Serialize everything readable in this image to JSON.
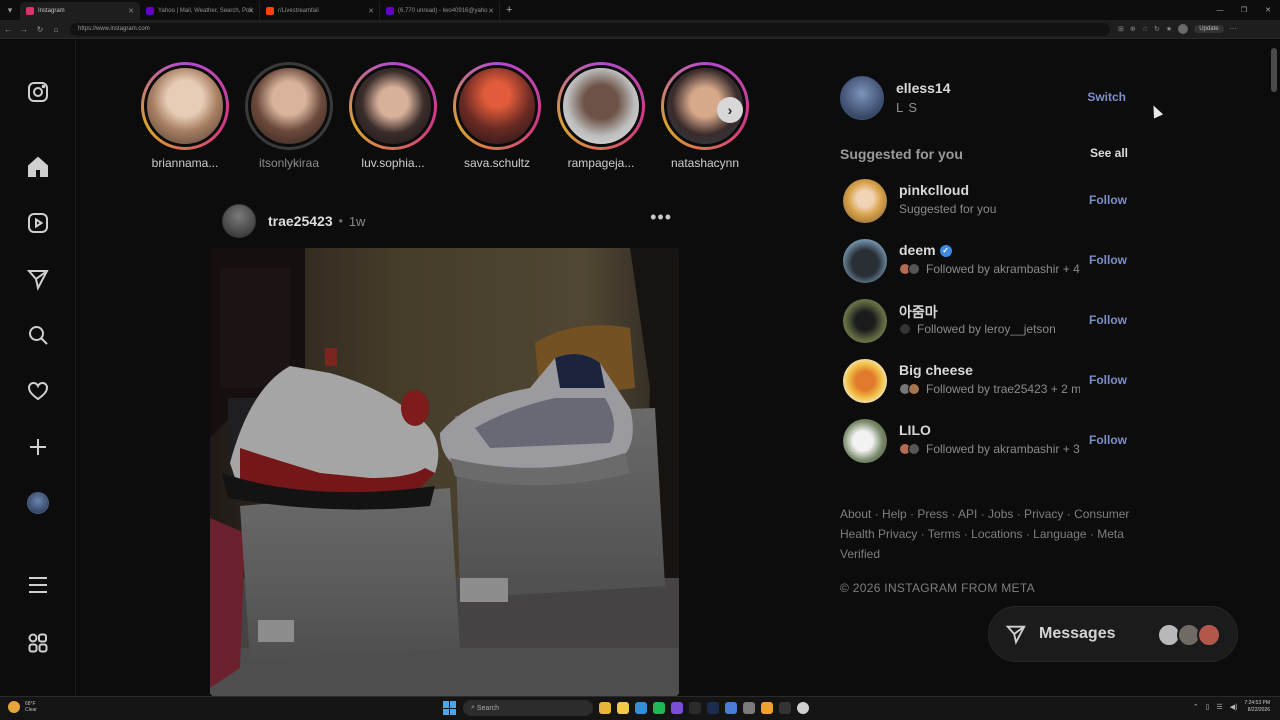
{
  "browser": {
    "tabs": [
      {
        "label": "Instagram",
        "active": true,
        "color": "#e1306c"
      },
      {
        "label": "Yahoo | Mail, Weather, Search, Poli",
        "active": false,
        "color": "#6001d2"
      },
      {
        "label": "r/Livestreamfail",
        "active": false,
        "color": "#ff4500"
      },
      {
        "label": "(6,770 unread) - lwo40916@yaho",
        "active": false,
        "color": "#6001d2"
      }
    ],
    "url": "https://www.instagram.com",
    "update_label": "Update"
  },
  "stories": [
    {
      "name": "briannama...",
      "seen": false
    },
    {
      "name": "itsonlykiraa",
      "seen": true
    },
    {
      "name": "luv.sophia...",
      "seen": false
    },
    {
      "name": "sava.schultz",
      "seen": false
    },
    {
      "name": "rampageja...",
      "seen": false
    },
    {
      "name": "natashacynn",
      "seen": false
    }
  ],
  "post": {
    "username": "trae25423",
    "dot": "•",
    "time": "1w",
    "more": "•••"
  },
  "me": {
    "username": "elless14",
    "full_name": "L S",
    "switch_label": "Switch"
  },
  "suggestions": {
    "title": "Suggested for you",
    "see_all": "See all",
    "follow_label": "Follow",
    "items": [
      {
        "username": "pinkclloud",
        "sub": "Suggested for you",
        "verified": false
      },
      {
        "username": "deem",
        "sub": "Followed by akrambashir + 4",
        "verified": true
      },
      {
        "username": "아줌마",
        "sub": "Followed by leroy__jetson",
        "verified": false
      },
      {
        "username": "Big cheese",
        "sub": "Followed by trae25423 + 2 m",
        "verified": false
      },
      {
        "username": "LILO",
        "sub": "Followed by akrambashir + 3",
        "verified": false
      }
    ]
  },
  "footer": {
    "links": "About · Help · Press · API · Jobs · Privacy · Consumer Health Privacy · Terms · Locations · Language · Meta Verified",
    "copyright": "© 2026 INSTAGRAM FROM META"
  },
  "messages": {
    "label": "Messages"
  },
  "taskbar": {
    "temp": "68°F",
    "condition": "Clear",
    "search": "Search",
    "time": "7:24:53 PM",
    "date": "8/22/2026"
  },
  "colors": {
    "accent": "#7d8fc9",
    "story_ring": "#d33a7d",
    "verified": "#3d8ae6"
  }
}
